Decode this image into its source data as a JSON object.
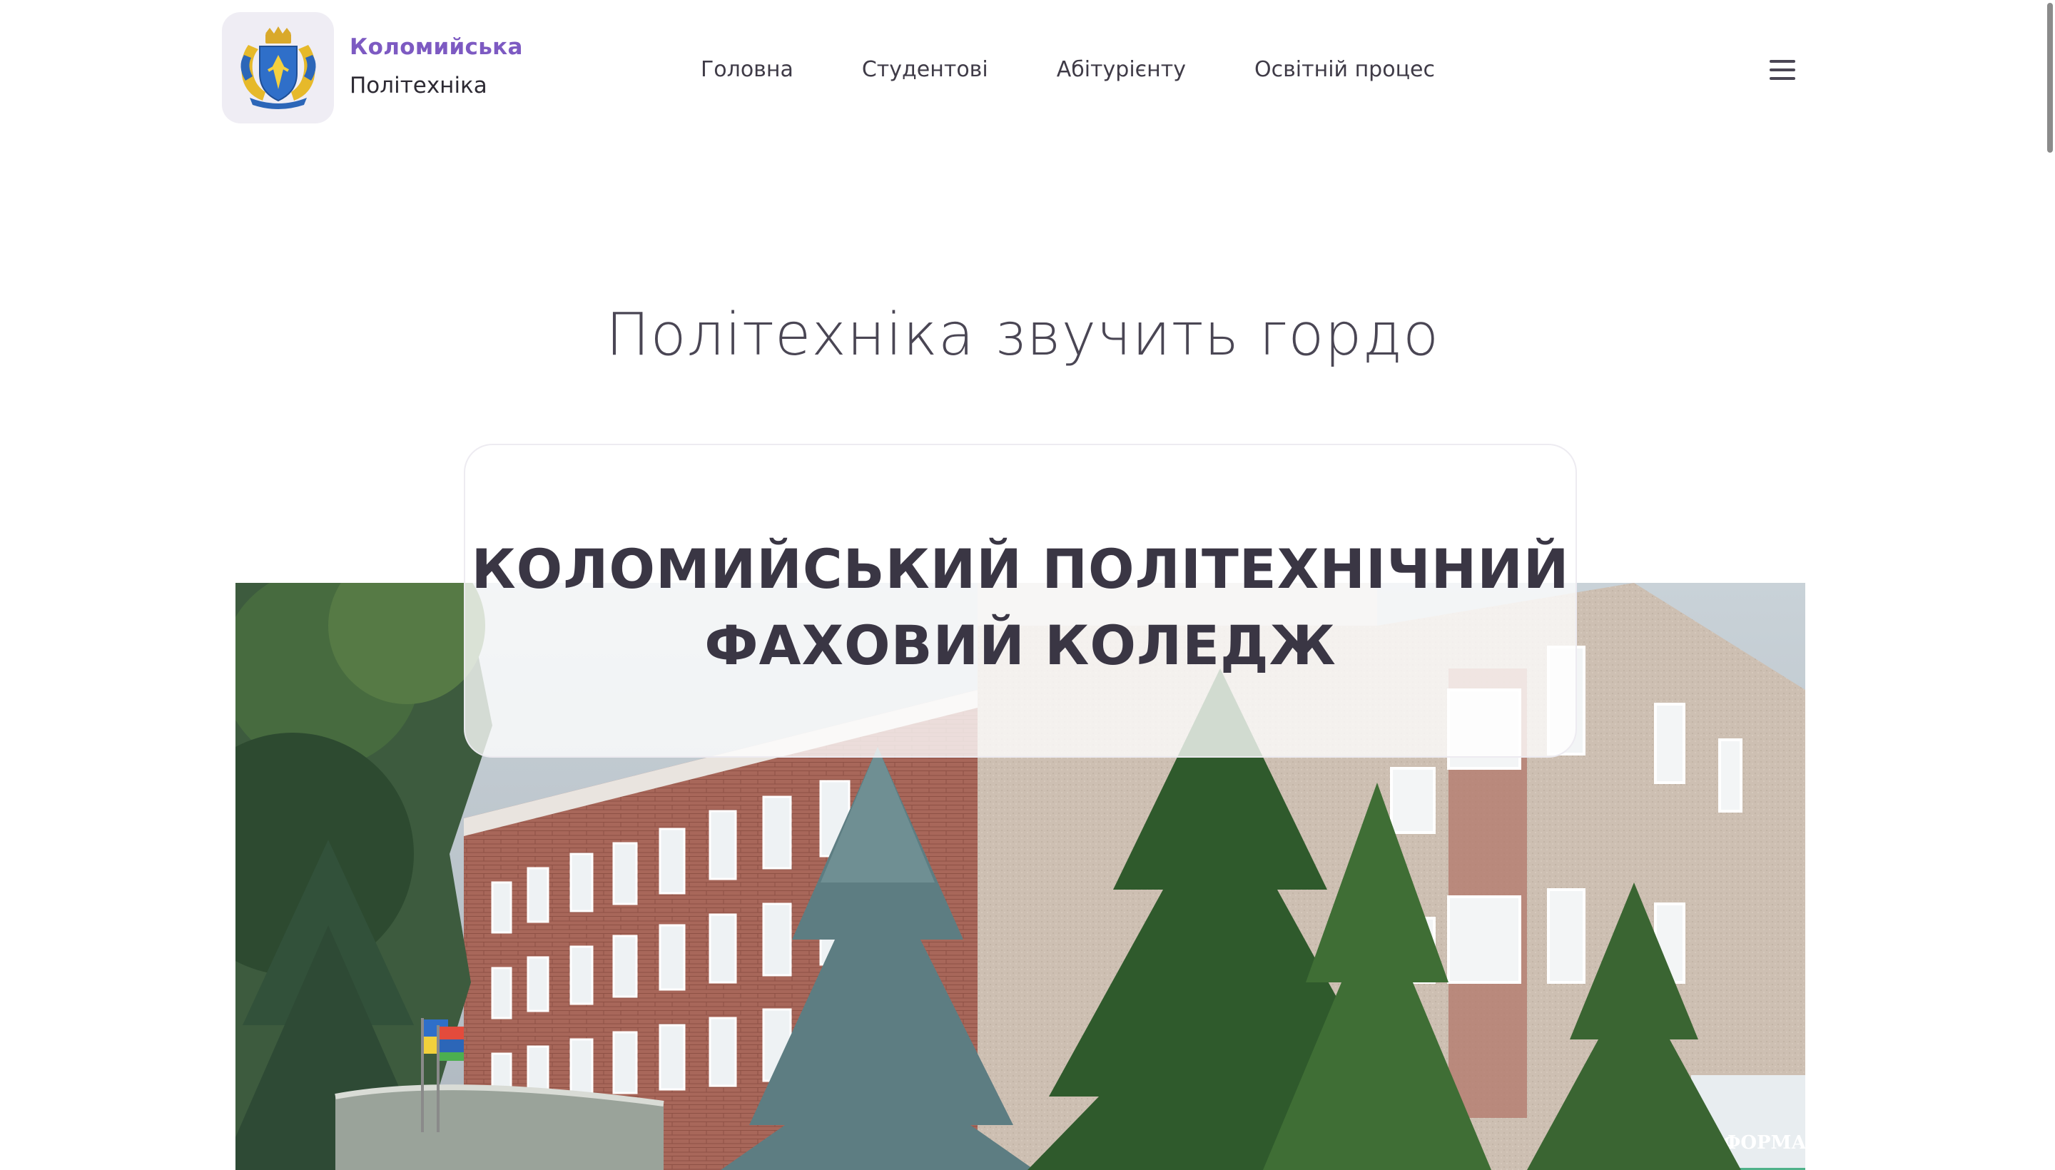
{
  "brand": {
    "line1": "Коломийська",
    "line2": "Політехніка",
    "colors": {
      "accent": "#7d5ac2",
      "tile": "#efedf4"
    }
  },
  "nav": {
    "items": [
      {
        "label": "Головна"
      },
      {
        "label": "Студентові"
      },
      {
        "label": "Абітурієнту"
      },
      {
        "label": "Освітній процес"
      }
    ],
    "menu_icon": "hamburger-menu-icon"
  },
  "hero": {
    "tagline": "Політехніка звучить гордо",
    "title_line1": "КОЛОМИЙСЬКИЙ ПОЛІТЕХНІЧНИЙ",
    "title_line2": "ФАХОВИЙ КОЛЕДЖ",
    "photo_sign_text": "ІНФОРМА"
  }
}
